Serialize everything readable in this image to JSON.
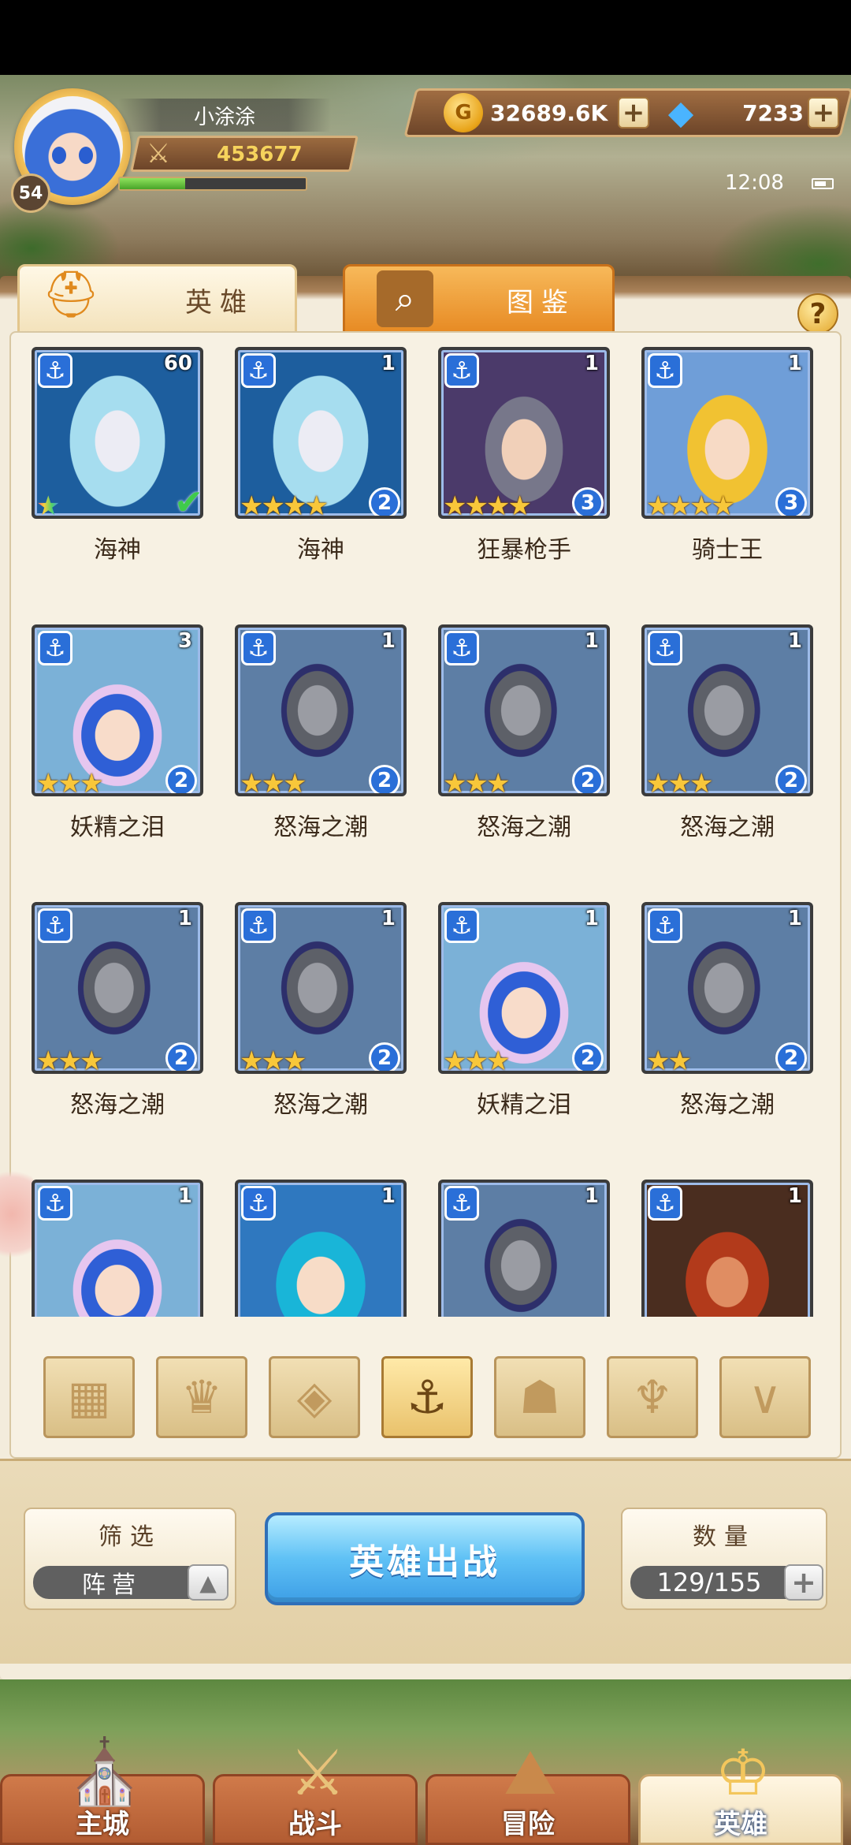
{
  "player": {
    "name": "小涂涂",
    "level": "54",
    "power": "453677",
    "exp_fraction": 0.35
  },
  "resources": {
    "gold": "32689.6K",
    "gems": "7233",
    "gold_icon_glyph": "G"
  },
  "status": {
    "time": "12:08"
  },
  "tabs": [
    {
      "label": "英雄",
      "active": true
    },
    {
      "label": "图鉴",
      "active": false
    }
  ],
  "heroes": [
    {
      "name": "海神",
      "level": "60",
      "stars": 1,
      "rainbow": true,
      "rank": "",
      "checked": true,
      "portrait": "neptune"
    },
    {
      "name": "海神",
      "level": "1",
      "stars": 4,
      "rank": "2",
      "portrait": "neptune"
    },
    {
      "name": "狂暴枪手",
      "level": "1",
      "stars": 4,
      "rank": "3",
      "portrait": "gunner"
    },
    {
      "name": "骑士王",
      "level": "1",
      "stars": 4,
      "rank": "3",
      "portrait": "knightking"
    },
    {
      "name": "妖精之泪",
      "level": "3",
      "stars": 3,
      "rank": "2",
      "portrait": "fairy"
    },
    {
      "name": "怒海之潮",
      "level": "1",
      "stars": 3,
      "rank": "2",
      "portrait": "knight"
    },
    {
      "name": "怒海之潮",
      "level": "1",
      "stars": 3,
      "rank": "2",
      "portrait": "knight"
    },
    {
      "name": "怒海之潮",
      "level": "1",
      "stars": 3,
      "rank": "2",
      "portrait": "knight"
    },
    {
      "name": "怒海之潮",
      "level": "1",
      "stars": 3,
      "rank": "2",
      "portrait": "knight"
    },
    {
      "name": "怒海之潮",
      "level": "1",
      "stars": 3,
      "rank": "2",
      "portrait": "knight"
    },
    {
      "name": "妖精之泪",
      "level": "1",
      "stars": 3,
      "rank": "2",
      "portrait": "fairy"
    },
    {
      "name": "怒海之潮",
      "level": "1",
      "stars": 2,
      "rank": "2",
      "portrait": "knight"
    },
    {
      "name": "",
      "level": "1",
      "stars": 0,
      "rank": "",
      "portrait": "fairy"
    },
    {
      "name": "",
      "level": "1",
      "stars": 0,
      "rank": "",
      "portrait": "teal"
    },
    {
      "name": "",
      "level": "1",
      "stars": 0,
      "rank": "",
      "portrait": "knight"
    },
    {
      "name": "",
      "level": "1",
      "stars": 0,
      "rank": "",
      "portrait": "pirate"
    }
  ],
  "camp_filters": [
    {
      "icon": "grid-icon",
      "glyph": "▦",
      "active": false
    },
    {
      "icon": "flame-crown-icon",
      "glyph": "♛",
      "active": false
    },
    {
      "icon": "chevron-emblem-icon",
      "glyph": "◈",
      "active": false
    },
    {
      "icon": "anchor-icon",
      "glyph": "⚓",
      "active": true
    },
    {
      "icon": "beast-head-icon",
      "glyph": "☗",
      "active": false
    },
    {
      "icon": "demon-horns-icon",
      "glyph": "♆",
      "active": false
    },
    {
      "icon": "wings-v-icon",
      "glyph": "∨",
      "active": false
    }
  ],
  "filter": {
    "title": "筛选",
    "value": "阵营",
    "toggle_glyph": "▲"
  },
  "deploy": {
    "label": "英雄出战"
  },
  "count": {
    "title": "数量",
    "value": "129/155"
  },
  "glyphs": {
    "plus": "+",
    "gem": "◆",
    "help": "?",
    "anchor": "⚓",
    "star": "★",
    "check": "✔",
    "helmet": "⛑",
    "magnifier": "⌕"
  },
  "nav": [
    {
      "label": "主城",
      "icon": "castle-icon",
      "glyph": "⛪",
      "active": false
    },
    {
      "label": "战斗",
      "icon": "crossed-swords-icon",
      "glyph": "⚔",
      "active": false
    },
    {
      "label": "冒险",
      "icon": "scroll-map-icon",
      "glyph": "⛰",
      "active": false
    },
    {
      "label": "英雄",
      "icon": "hero-helmet-icon",
      "glyph": "♔",
      "active": true
    }
  ],
  "colors": {
    "accent_orange": "#e78a23",
    "deploy_blue": "#5fc1f5",
    "faction_blue": "#2a6fd8",
    "gold_text": "#f6d35c",
    "exp_green": "#49a428"
  }
}
